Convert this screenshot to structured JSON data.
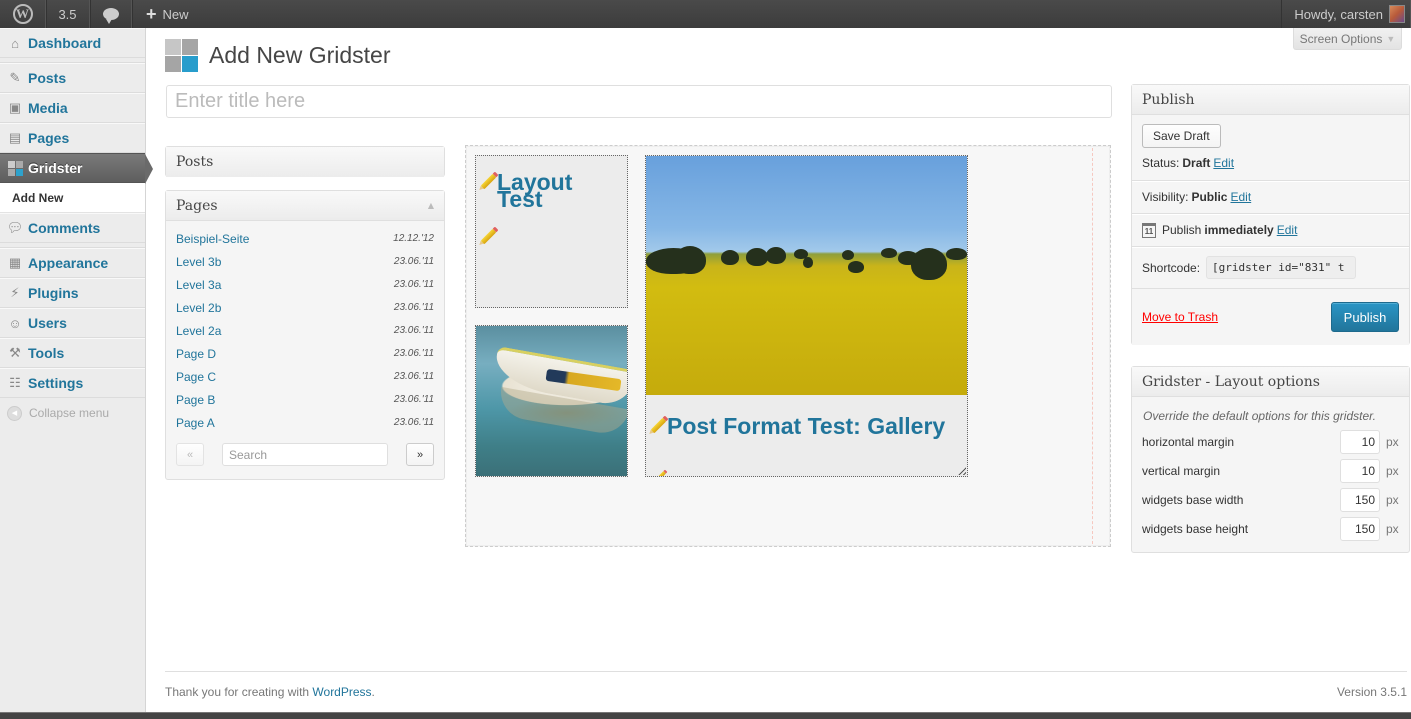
{
  "adminbar": {
    "wp_logo": "wordpress-logo-icon",
    "version": "3.5",
    "comments_icon": "comment-bubble-icon",
    "new_label": "New",
    "howdy": "Howdy, carsten"
  },
  "sidebar": {
    "items": [
      {
        "label": "Dashboard",
        "icon": "home-icon"
      },
      {
        "label": "Posts",
        "icon": "pushpin-icon"
      },
      {
        "label": "Media",
        "icon": "media-icon"
      },
      {
        "label": "Pages",
        "icon": "pages-icon"
      },
      {
        "label": "Gridster",
        "icon": "gridster-icon",
        "current": true
      },
      {
        "label": "Comments",
        "icon": "comments-icon"
      },
      {
        "label": "Appearance",
        "icon": "appearance-icon"
      },
      {
        "label": "Plugins",
        "icon": "plugin-icon"
      },
      {
        "label": "Users",
        "icon": "users-icon"
      },
      {
        "label": "Tools",
        "icon": "tools-icon"
      },
      {
        "label": "Settings",
        "icon": "settings-icon"
      }
    ],
    "submenu_add_new": "Add New",
    "collapse": "Collapse menu"
  },
  "header": {
    "title": "Add New Gridster",
    "screen_options": "Screen Options",
    "title_placeholder": "Enter title here"
  },
  "posts_box": {
    "title": "Posts"
  },
  "pages_box": {
    "title": "Pages",
    "items": [
      {
        "title": "Beispiel-Seite",
        "date": "12.12.'12"
      },
      {
        "title": "Level 3b",
        "date": "23.06.'11"
      },
      {
        "title": "Level 3a",
        "date": "23.06.'11"
      },
      {
        "title": "Level 2b",
        "date": "23.06.'11"
      },
      {
        "title": "Level 2a",
        "date": "23.06.'11"
      },
      {
        "title": "Page D",
        "date": "23.06.'11"
      },
      {
        "title": "Page C",
        "date": "23.06.'11"
      },
      {
        "title": "Page B",
        "date": "23.06.'11"
      },
      {
        "title": "Page A",
        "date": "23.06.'11"
      }
    ],
    "prev": "«",
    "next": "»",
    "search_placeholder": "Search"
  },
  "gridster": {
    "widgets": [
      {
        "title": "Layout Test",
        "type": "text"
      },
      {
        "title": "",
        "type": "image",
        "image": "rowboat-on-clear-water"
      },
      {
        "title": "Post Format Test: Gallery",
        "type": "image+text",
        "image": "canola-field-landscape"
      }
    ]
  },
  "publish": {
    "title": "Publish",
    "save_draft": "Save Draft",
    "status_label": "Status:",
    "status_value": "Draft",
    "visibility_label": "Visibility:",
    "visibility_value": "Public",
    "schedule_label": "Publish",
    "schedule_value": "immediately",
    "edit": "Edit",
    "calendar_day": "11",
    "shortcode_label": "Shortcode:",
    "shortcode_value": "[gridster id=\"831\" t",
    "move_to_trash": "Move to Trash",
    "publish_button": "Publish"
  },
  "layout_options": {
    "title": "Gridster - Layout options",
    "description": "Override the default options for this gridster.",
    "fields": [
      {
        "label": "horizontal margin",
        "value": "10",
        "unit": "px"
      },
      {
        "label": "vertical margin",
        "value": "10",
        "unit": "px"
      },
      {
        "label": "widgets base width",
        "value": "150",
        "unit": "px"
      },
      {
        "label": "widgets base height",
        "value": "150",
        "unit": "px"
      }
    ]
  },
  "footer": {
    "thanks_prefix": "Thank you for creating with ",
    "wordpress_link": "WordPress",
    "thanks_suffix": ".",
    "version": "Version 3.5.1"
  },
  "colors": {
    "link": "#21759b",
    "accent": "#2ea2cc",
    "trash": "#ff0000",
    "adminbar": "#464646"
  }
}
